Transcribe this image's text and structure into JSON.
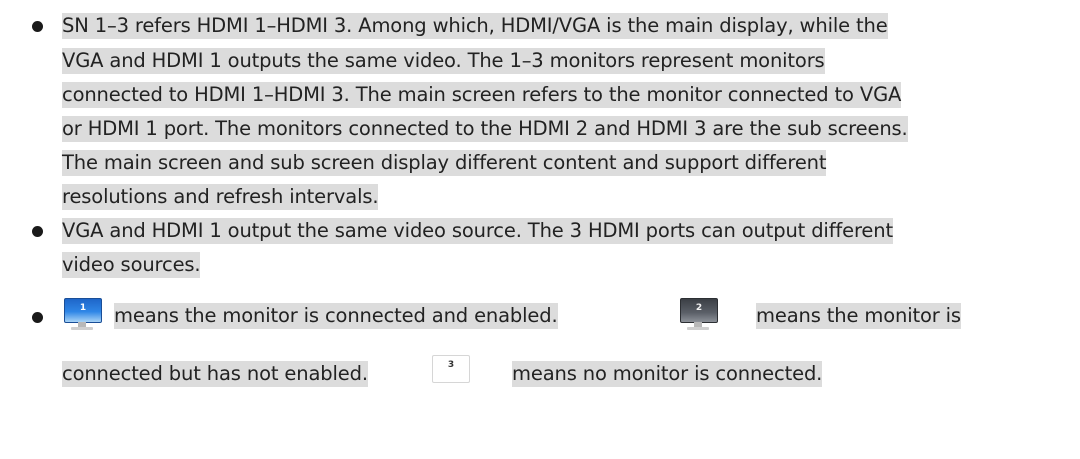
{
  "bullets": [
    {
      "lines": [
        "SN 1–3 refers HDMI 1–HDMI 3. Among which, HDMI/VGA is the main display, while the",
        "VGA and HDMI 1 outputs the same video. The 1–3 monitors represent monitors",
        "connected to HDMI 1–HDMI 3. The main screen refers to the monitor connected to VGA",
        "or HDMI 1 port. The monitors connected to the HDMI 2 and HDMI 3 are the sub screens.",
        "The main screen and sub screen display different content and support different",
        "resolutions and refresh intervals."
      ]
    },
    {
      "lines": [
        "VGA and HDMI 1 output the same video source. The 3 HDMI ports can output different",
        "video sources."
      ]
    },
    {
      "icon_enabled": {
        "icon": "monitor-enabled-icon",
        "number": "1",
        "color": "#2f86e6"
      },
      "text_enabled": "means the monitor is connected and enabled.",
      "icon_disabled": {
        "icon": "monitor-disabled-icon",
        "number": "2",
        "color": "#5b6068"
      },
      "text_disabled_1": "means the monitor is",
      "text_disabled_2": "connected but has not enabled.",
      "icon_none": {
        "icon": "monitor-not-connected-icon",
        "number": "3",
        "color": "#ffffff"
      },
      "text_none": "means no monitor is connected."
    }
  ],
  "highlight_color": "#dcdcdc"
}
